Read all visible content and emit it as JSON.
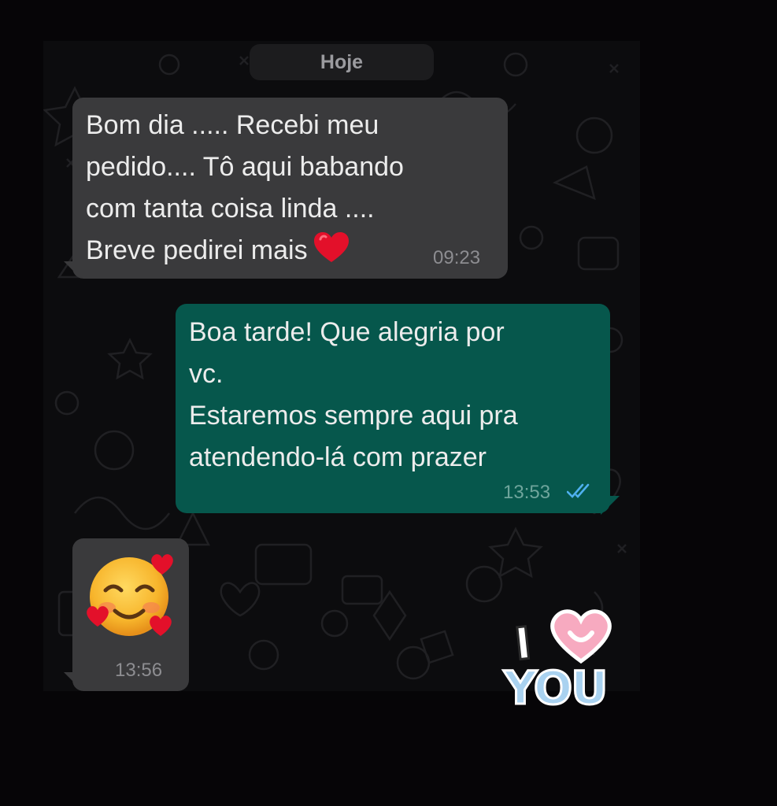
{
  "chat": {
    "date_label": "Hoje",
    "messages": [
      {
        "direction": "incoming",
        "text": "Bom dia ..... Recebi meu\npedido.... Tô aqui babando\ncom tanta coisa linda ....\nBreve pedirei mais",
        "emoji": "red-heart",
        "time": "09:23"
      },
      {
        "direction": "outgoing",
        "text": "Boa tarde! Que alegria por\nvc.\nEstaremos sempre aqui pra\natendendo-lá com prazer",
        "time": "13:53",
        "status": "read"
      },
      {
        "direction": "incoming",
        "emoji": "smiling-face-with-hearts",
        "time": "13:56"
      }
    ]
  },
  "sticker": {
    "line1": "I",
    "line2": "YOU",
    "icon": "heart-icon"
  },
  "colors": {
    "incoming_bubble": "#3a3a3c",
    "outgoing_bubble": "#06574c",
    "read_ticks": "#4fb0ef",
    "heart_red": "#e3102a"
  }
}
